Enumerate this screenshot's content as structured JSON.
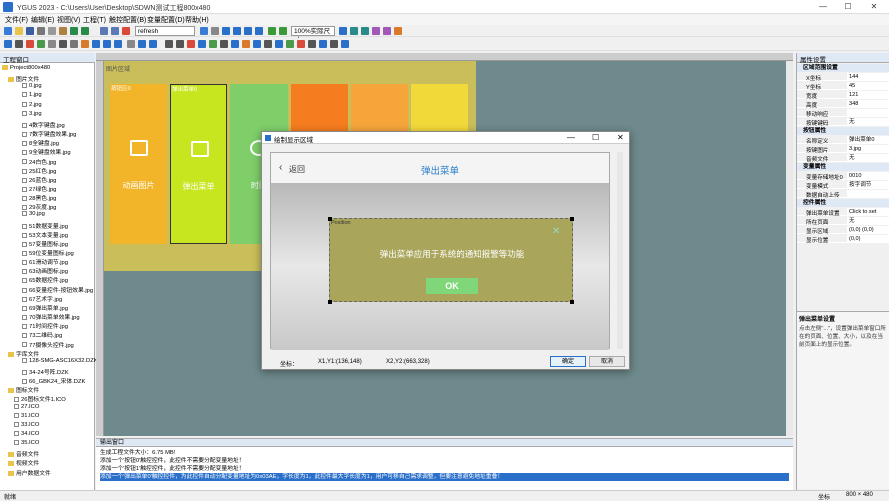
{
  "window": {
    "title": "YGUS 2023 - C:\\Users\\User\\Desktop\\SDWN测试工程800x480",
    "min": "—",
    "max": "☐",
    "close": "✕"
  },
  "menu": [
    "文件(F)",
    "编辑(E)",
    "视图(V)",
    "工程(T)",
    "触控配置(B)",
    "变量配置(D)",
    "帮助(H)"
  ],
  "toolbar": {
    "refresh_combo": "refresh",
    "zoom_combo": "100%实际尺寸"
  },
  "project_panel": {
    "title": "工程窗口",
    "root": "Project800x480",
    "image_folder": "图片文件",
    "images": [
      "0.jpg",
      "1.jpg",
      "2.jpg",
      "3.jpg",
      "4数字键盘.jpg",
      "7数字键盘效果.jpg",
      "8全键盘.jpg",
      "9全键盘效果.jpg",
      "24白色.jpg",
      "25红色.jpg",
      "26蓝色.jpg",
      "27绿色.jpg",
      "28黑色.jpg",
      "29灰度.jpg",
      "30.jpg",
      "51数据变量.jpg",
      "53文本变量.jpg",
      "57变量图标.jpg",
      "59位变量图标.jpg",
      "61滑动调节.jpg",
      "63动画图标.jpg",
      "65数据控件.jpg",
      "66变量控件-按钮效果.jpg",
      "67艺术字.jpg",
      "69弹出菜单.jpg",
      "70弹出菜单效果.jpg",
      "71时间控件.jpg",
      "73二维码.jpg",
      "77摄像头控件.jpg"
    ],
    "font_folder": "字库文件",
    "fonts": [
      "128-SMG-ASC16X32.DZK",
      "34-24号阵.DZK",
      "66_GBK24_宋体.DZK"
    ],
    "icon_folder": "图标文件",
    "icons": [
      "26图标文件1.ICO",
      "27.ICO",
      "31.ICO",
      "33.ICO",
      "34.ICO",
      "35.ICO"
    ],
    "audio_folder": "音频文件",
    "video_folder": "视频文件",
    "user_folder": "用户数据文件"
  },
  "canvas": {
    "page_label": "图片区域",
    "tiles": [
      {
        "top_label": "按钮区0",
        "text": "动画图片",
        "color": "#f2b52a",
        "icon": "image-icon"
      },
      {
        "top_label": "弹出菜单0",
        "text": "弹出菜单",
        "color": "#c8e620",
        "icon": "menu-icon"
      },
      {
        "top_label": "",
        "text": "时间",
        "color": "#7fce6a",
        "icon": "clock-icon"
      },
      {
        "top_label": "",
        "text": "",
        "color": "#f57c1f",
        "icon": ""
      },
      {
        "top_label": "",
        "text": "",
        "color": "#f5a53a",
        "icon": ""
      },
      {
        "top_label": "",
        "text": "",
        "color": "#f2d93a",
        "icon": ""
      }
    ]
  },
  "dialog": {
    "title": "绘制显示区域",
    "back": "返回",
    "header": "弹出菜单",
    "position_label": "Position",
    "message": "弹出菜单应用于系统的通知报警等功能",
    "ok": "OK",
    "coord_label": "坐标：",
    "xy1": "X1,Y1:(136,148)",
    "xy2": "X2,Y2:(663,328)",
    "confirm": "确定",
    "cancel": "取消"
  },
  "properties": {
    "title": "属性设置",
    "sections": [
      {
        "name": "区域范围设置",
        "rows": [
          [
            "X坐标",
            "144"
          ],
          [
            "Y坐标",
            "45"
          ],
          [
            "宽度",
            "121"
          ],
          [
            "高度",
            "348"
          ],
          [
            "移动响应",
            ""
          ],
          [
            "按键键码",
            "无"
          ]
        ]
      },
      {
        "name": "按钮属性",
        "rows": [
          [
            "名称定义",
            "弹出菜单0"
          ],
          [
            "按键图片",
            "3.jpg"
          ],
          [
            "音频文件",
            "无"
          ]
        ]
      },
      {
        "name": "变量属性",
        "rows": [
          [
            "变量存储地址0",
            "0010"
          ],
          [
            "变量模式",
            "按字调节"
          ],
          [
            "数据自动上传",
            ""
          ]
        ]
      },
      {
        "name": "控件属性",
        "rows": [
          [
            "弹出菜单设置",
            "Click to set"
          ],
          [
            "所在页面",
            "无"
          ],
          [
            "显示区域",
            "(0,0) (0,0)"
          ],
          [
            "显示位置",
            "(0,0)"
          ]
        ]
      }
    ],
    "help_title": "弹出菜单设置",
    "help_text": "点击左侧\"...\"，设置弹出菜单窗口所在的页面、位置、大小，以及在当前页面上的显示位置。"
  },
  "output": {
    "title": "输出窗口",
    "lines": [
      "生成工程文件大小：6.75 MB!",
      "添加一个'按钮0'触控控件，此控件不需要分配变量地址！",
      "添加一个'按钮1'触控控件，此控件不需要分配变量地址！",
      "添加一个'弹出菜单0'触控控件，为此控件自动分配变量地址为0x03AE，字长度为1，此控件最大字长度为1，用户可移自己需求调整，但要注意避免地址重叠！"
    ]
  },
  "status": {
    "left": "就绪",
    "coords": "坐标",
    "size": "800 × 480"
  }
}
